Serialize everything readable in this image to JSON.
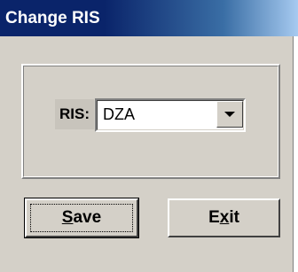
{
  "window": {
    "title": "Change RIS"
  },
  "form": {
    "ris_label": "RIS:",
    "ris_value": "DZA"
  },
  "buttons": {
    "save_label_mnemonic": "S",
    "save_label_rest": "ave",
    "exit_label_first": "E",
    "exit_label_mnemonic": "x",
    "exit_label_rest": "it"
  },
  "icons": {
    "dropdown": "chevron-down-icon"
  },
  "colors": {
    "titlebar": "#0a246a",
    "face": "#d4d0c8"
  }
}
